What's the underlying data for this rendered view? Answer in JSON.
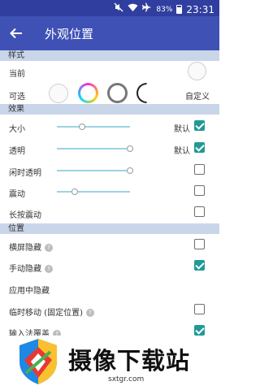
{
  "status": {
    "battery": "83%",
    "time": "23:31"
  },
  "appbar": {
    "title": "外观位置"
  },
  "sections": {
    "style": "样式",
    "effects": "效果",
    "position": "位置"
  },
  "style": {
    "current_label": "当前",
    "options_label": "可选",
    "custom_label": "自定义"
  },
  "effects": {
    "size_label": "大小",
    "size_level": 0.34,
    "size_default_label": "默认",
    "size_default_checked": true,
    "opacity_label": "透明",
    "opacity_level": 1.0,
    "opacity_default_label": "默认",
    "opacity_default_checked": true,
    "idle_opacity_label": "闲时透明",
    "idle_opacity_level": 1.0,
    "idle_opacity_checked": false,
    "vibrate_label": "震动",
    "vibrate_level": 0.24,
    "vibrate_checked": false,
    "long_press_vibrate_label": "长按震动",
    "long_press_vibrate_checked": false
  },
  "position": {
    "landscape_hide_label": "横屏隐藏",
    "landscape_hide_checked": false,
    "manual_hide_label": "手动隐藏",
    "manual_hide_checked": true,
    "app_hide_label": "应用中隐藏",
    "temp_move_label": "临时移动 (固定位置)",
    "temp_move_checked": false,
    "ime_cover_label": "输入法覆盖",
    "ime_cover_checked": true
  },
  "watermark": {
    "brand": "摄像下载站",
    "url": "sxtgr.com"
  },
  "colors": {
    "statusbar": "#303f9f",
    "appbar": "#3f51b5",
    "section": "#c9d5e9",
    "accent": "#1f9b96",
    "slider": "#9ad3e4"
  }
}
